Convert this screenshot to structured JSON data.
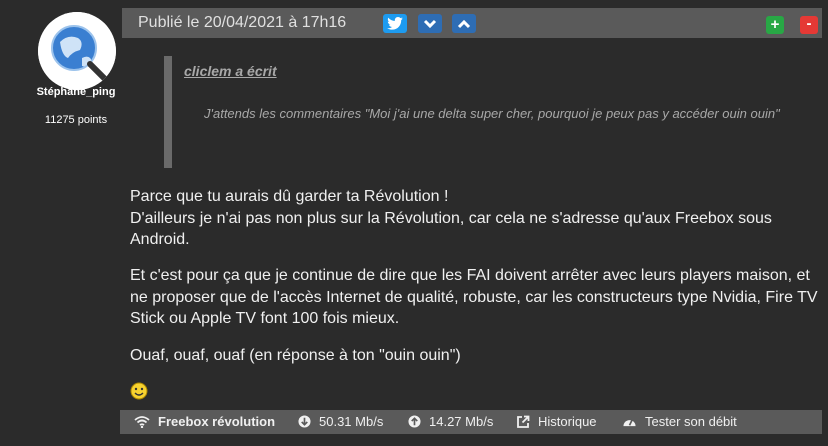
{
  "author": {
    "name": "Stéphane_ping",
    "points": "11275 points",
    "avatar_icon": "globe-magnifier-icon"
  },
  "header": {
    "published": "Publié le 20/04/2021 à 17h16",
    "twitter_icon": "twitter-icon",
    "down_icon": "chevron-down-icon",
    "up_icon": "chevron-up-icon",
    "plus_label": "+",
    "minus_label": "-",
    "colors": {
      "bar": "#5a5a5a",
      "twitter": "#1d9bf0",
      "nav": "#2e6db4",
      "plus": "#28a745",
      "minus": "#e53935"
    }
  },
  "quote": {
    "author_line": "cliclem a écrit",
    "text": "J'attends les commentaires \"Moi j'ai une delta super cher, pourquoi je peux pas y accéder ouin ouin\""
  },
  "body": {
    "p1_line1": "Parce que tu aurais dû garder ta Révolution !",
    "p1_line2": "D'ailleurs je n'ai pas non plus sur la Révolution, car cela ne s'adresse qu'aux Freebox sous Android.",
    "p2": "Et c'est pour ça que je continue de dire que les FAI doivent arrêter avec leurs players maison, et ne proposer que de l'accès Internet de qualité, robuste, car les constructeurs type Nvidia, Fire TV Stick ou Apple TV font 100 fois mieux.",
    "p3": "Ouaf, ouaf, ouaf (en réponse à ton \"ouin ouin\")",
    "emoji": "smiley-icon"
  },
  "footer": {
    "connection": "Freebox révolution",
    "download": "50.31 Mb/s",
    "upload": "14.27 Mb/s",
    "history": "Historique",
    "speedtest": "Tester son débit"
  }
}
